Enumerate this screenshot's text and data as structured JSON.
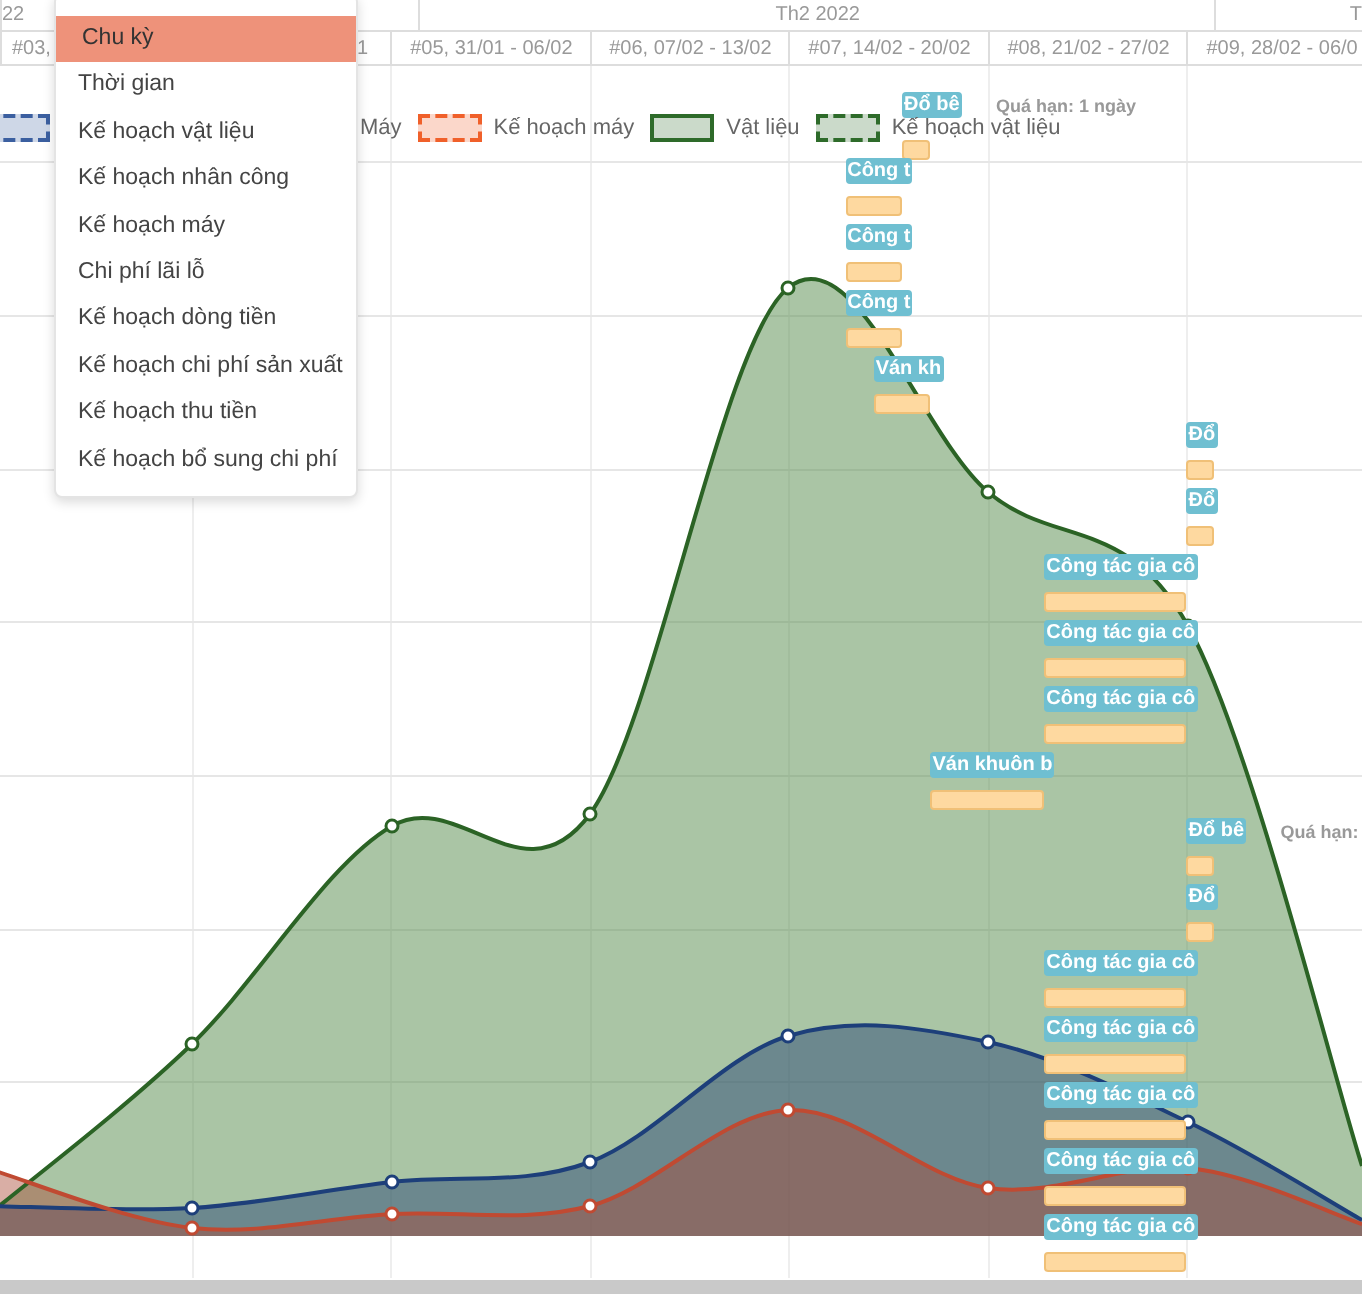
{
  "timeline": {
    "months": [
      {
        "label": "22"
      },
      {
        "label": "Th2 2022"
      },
      {
        "label": "T"
      }
    ],
    "weeks": [
      {
        "label": "#03,"
      },
      {
        "label": "1"
      },
      {
        "label": "#05, 31/01 - 06/02"
      },
      {
        "label": "#06, 07/02 - 13/02"
      },
      {
        "label": "#07, 14/02 - 20/02"
      },
      {
        "label": "#08, 21/02 - 27/02"
      },
      {
        "label": "#09, 28/02 - 06/0"
      }
    ]
  },
  "legend": [
    {
      "color": "#3b5fa0",
      "kind": "dashed"
    },
    {
      "label": "Máy"
    },
    {
      "label": "Kế hoạch máy",
      "color": "#f0602a",
      "kind": "dashed"
    },
    {
      "label": "Vật liệu",
      "color": "#2e6b2a",
      "kind": "solid"
    },
    {
      "label": "Kế hoạch vật liệu",
      "color": "#2e6b2a",
      "kind": "dashed"
    }
  ],
  "tasks": [
    {
      "label": "Đổ bê",
      "note": "Quá hạn: 1 ngày"
    },
    {
      "label": "Công t"
    },
    {
      "label": "Công t"
    },
    {
      "label": "Công t"
    },
    {
      "label": "Ván kh"
    },
    {
      "label": "Đổ"
    },
    {
      "label": "Đổ"
    },
    {
      "label": "Công tác gia cô"
    },
    {
      "label": "Công tác gia cô"
    },
    {
      "label": "Công tác gia cô"
    },
    {
      "label": "Ván khuôn b"
    },
    {
      "label": "Đổ bê",
      "note": "Quá hạn:"
    },
    {
      "label": "Đổ"
    },
    {
      "label": "Công tác gia cô"
    },
    {
      "label": "Công tác gia cô"
    },
    {
      "label": "Công tác gia cô"
    },
    {
      "label": "Công tác gia cô"
    },
    {
      "label": "Công tác gia cô"
    }
  ],
  "menu": {
    "items": [
      {
        "label": "Chu kỳ",
        "selected": true
      },
      {
        "label": "Thời gian",
        "selected": false
      },
      {
        "label": "Kế hoạch vật liệu",
        "selected": false
      },
      {
        "label": "Kế hoạch nhân công",
        "selected": false
      },
      {
        "label": "Kế hoạch máy",
        "selected": false
      },
      {
        "label": "Chi phí lãi lỗ",
        "selected": false
      },
      {
        "label": "Kế hoạch dòng tiền",
        "selected": false
      },
      {
        "label": "Kế hoạch chi phí sản xuất",
        "selected": false
      },
      {
        "label": "Kế hoạch thu tiền",
        "selected": false
      },
      {
        "label": "Kế hoạch bổ sung chi phí",
        "selected": false
      }
    ]
  }
}
